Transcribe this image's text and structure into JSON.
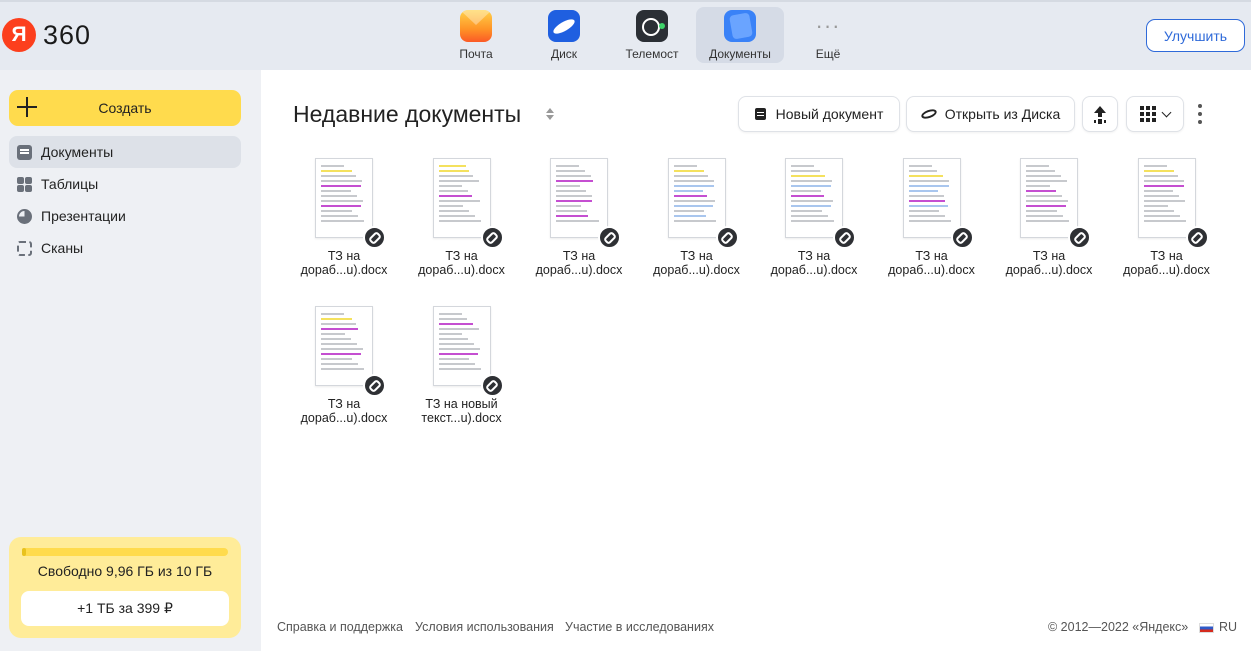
{
  "header": {
    "logo_letter": "Я",
    "logo_text": "360",
    "services": [
      {
        "label": "Почта",
        "icon": "mail-icon"
      },
      {
        "label": "Диск",
        "icon": "disk-icon"
      },
      {
        "label": "Телемост",
        "icon": "telemost-icon"
      },
      {
        "label": "Документы",
        "icon": "documents-icon",
        "active": true
      },
      {
        "label": "Ещё",
        "icon": "more-dots-icon"
      }
    ],
    "upgrade_label": "Улучшить"
  },
  "sidebar": {
    "create_label": "Создать",
    "items": [
      {
        "label": "Документы",
        "icon": "document-icon",
        "active": true
      },
      {
        "label": "Таблицы",
        "icon": "table-icon"
      },
      {
        "label": "Презентации",
        "icon": "presentation-icon"
      },
      {
        "label": "Сканы",
        "icon": "scan-icon"
      }
    ],
    "storage": {
      "text": "Свободно 9,96 ГБ из 10 ГБ",
      "used_fraction": 0.004,
      "buy_label": "+1 ТБ за 399 ₽"
    }
  },
  "main": {
    "title": "Недавние документы",
    "toolbar": {
      "new_doc_label": "Новый документ",
      "open_disk_label": "Открыть из Диска"
    },
    "files": [
      {
        "name_line1": "ТЗ на",
        "name_line2": "дораб...u).docx"
      },
      {
        "name_line1": "ТЗ на",
        "name_line2": "дораб...u).docx"
      },
      {
        "name_line1": "ТЗ на",
        "name_line2": "дораб...u).docx"
      },
      {
        "name_line1": "ТЗ на",
        "name_line2": "дораб...u).docx"
      },
      {
        "name_line1": "ТЗ на",
        "name_line2": "дораб...u).docx"
      },
      {
        "name_line1": "ТЗ на",
        "name_line2": "дораб...u).docx"
      },
      {
        "name_line1": "ТЗ на",
        "name_line2": "дораб...u).docx"
      },
      {
        "name_line1": "ТЗ на",
        "name_line2": "дораб...u).docx"
      },
      {
        "name_line1": "ТЗ на",
        "name_line2": "дораб...u).docx"
      },
      {
        "name_line1": "ТЗ на новый",
        "name_line2": "текст...u).docx"
      }
    ]
  },
  "footer": {
    "links": [
      "Справка и поддержка",
      "Условия использования",
      "Участие в исследованиях"
    ],
    "copyright": "© 2012—2022 «Яндекс»",
    "lang": "RU"
  },
  "colors": {
    "accent_yellow": "#ffdb4d",
    "link_blue": "#2f6ad9",
    "brand_red": "#fc3f1d"
  }
}
